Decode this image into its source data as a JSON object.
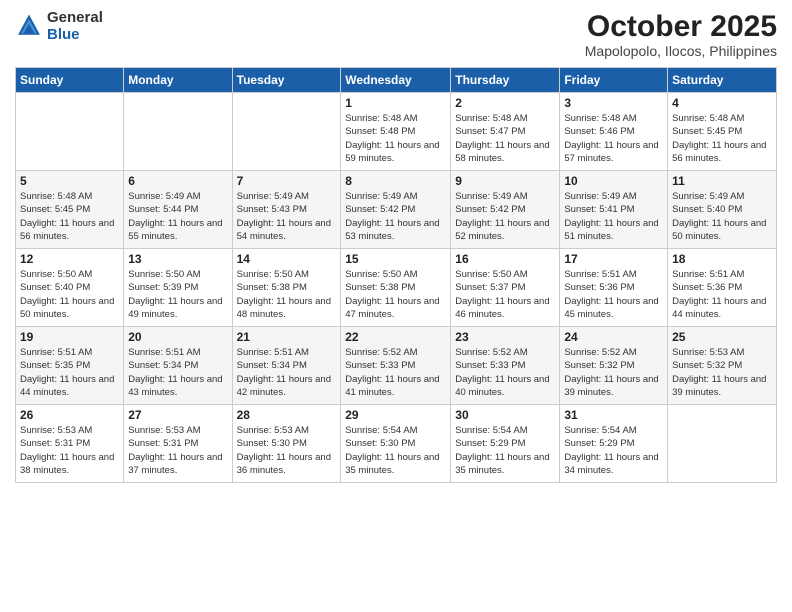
{
  "logo": {
    "general": "General",
    "blue": "Blue"
  },
  "title": "October 2025",
  "location": "Mapolopolo, Ilocos, Philippines",
  "days_of_week": [
    "Sunday",
    "Monday",
    "Tuesday",
    "Wednesday",
    "Thursday",
    "Friday",
    "Saturday"
  ],
  "weeks": [
    [
      {
        "day": "",
        "info": ""
      },
      {
        "day": "",
        "info": ""
      },
      {
        "day": "",
        "info": ""
      },
      {
        "day": "1",
        "info": "Sunrise: 5:48 AM\nSunset: 5:48 PM\nDaylight: 11 hours\nand 59 minutes."
      },
      {
        "day": "2",
        "info": "Sunrise: 5:48 AM\nSunset: 5:47 PM\nDaylight: 11 hours\nand 58 minutes."
      },
      {
        "day": "3",
        "info": "Sunrise: 5:48 AM\nSunset: 5:46 PM\nDaylight: 11 hours\nand 57 minutes."
      },
      {
        "day": "4",
        "info": "Sunrise: 5:48 AM\nSunset: 5:45 PM\nDaylight: 11 hours\nand 56 minutes."
      }
    ],
    [
      {
        "day": "5",
        "info": "Sunrise: 5:48 AM\nSunset: 5:45 PM\nDaylight: 11 hours\nand 56 minutes."
      },
      {
        "day": "6",
        "info": "Sunrise: 5:49 AM\nSunset: 5:44 PM\nDaylight: 11 hours\nand 55 minutes."
      },
      {
        "day": "7",
        "info": "Sunrise: 5:49 AM\nSunset: 5:43 PM\nDaylight: 11 hours\nand 54 minutes."
      },
      {
        "day": "8",
        "info": "Sunrise: 5:49 AM\nSunset: 5:42 PM\nDaylight: 11 hours\nand 53 minutes."
      },
      {
        "day": "9",
        "info": "Sunrise: 5:49 AM\nSunset: 5:42 PM\nDaylight: 11 hours\nand 52 minutes."
      },
      {
        "day": "10",
        "info": "Sunrise: 5:49 AM\nSunset: 5:41 PM\nDaylight: 11 hours\nand 51 minutes."
      },
      {
        "day": "11",
        "info": "Sunrise: 5:49 AM\nSunset: 5:40 PM\nDaylight: 11 hours\nand 50 minutes."
      }
    ],
    [
      {
        "day": "12",
        "info": "Sunrise: 5:50 AM\nSunset: 5:40 PM\nDaylight: 11 hours\nand 50 minutes."
      },
      {
        "day": "13",
        "info": "Sunrise: 5:50 AM\nSunset: 5:39 PM\nDaylight: 11 hours\nand 49 minutes."
      },
      {
        "day": "14",
        "info": "Sunrise: 5:50 AM\nSunset: 5:38 PM\nDaylight: 11 hours\nand 48 minutes."
      },
      {
        "day": "15",
        "info": "Sunrise: 5:50 AM\nSunset: 5:38 PM\nDaylight: 11 hours\nand 47 minutes."
      },
      {
        "day": "16",
        "info": "Sunrise: 5:50 AM\nSunset: 5:37 PM\nDaylight: 11 hours\nand 46 minutes."
      },
      {
        "day": "17",
        "info": "Sunrise: 5:51 AM\nSunset: 5:36 PM\nDaylight: 11 hours\nand 45 minutes."
      },
      {
        "day": "18",
        "info": "Sunrise: 5:51 AM\nSunset: 5:36 PM\nDaylight: 11 hours\nand 44 minutes."
      }
    ],
    [
      {
        "day": "19",
        "info": "Sunrise: 5:51 AM\nSunset: 5:35 PM\nDaylight: 11 hours\nand 44 minutes."
      },
      {
        "day": "20",
        "info": "Sunrise: 5:51 AM\nSunset: 5:34 PM\nDaylight: 11 hours\nand 43 minutes."
      },
      {
        "day": "21",
        "info": "Sunrise: 5:51 AM\nSunset: 5:34 PM\nDaylight: 11 hours\nand 42 minutes."
      },
      {
        "day": "22",
        "info": "Sunrise: 5:52 AM\nSunset: 5:33 PM\nDaylight: 11 hours\nand 41 minutes."
      },
      {
        "day": "23",
        "info": "Sunrise: 5:52 AM\nSunset: 5:33 PM\nDaylight: 11 hours\nand 40 minutes."
      },
      {
        "day": "24",
        "info": "Sunrise: 5:52 AM\nSunset: 5:32 PM\nDaylight: 11 hours\nand 39 minutes."
      },
      {
        "day": "25",
        "info": "Sunrise: 5:53 AM\nSunset: 5:32 PM\nDaylight: 11 hours\nand 39 minutes."
      }
    ],
    [
      {
        "day": "26",
        "info": "Sunrise: 5:53 AM\nSunset: 5:31 PM\nDaylight: 11 hours\nand 38 minutes."
      },
      {
        "day": "27",
        "info": "Sunrise: 5:53 AM\nSunset: 5:31 PM\nDaylight: 11 hours\nand 37 minutes."
      },
      {
        "day": "28",
        "info": "Sunrise: 5:53 AM\nSunset: 5:30 PM\nDaylight: 11 hours\nand 36 minutes."
      },
      {
        "day": "29",
        "info": "Sunrise: 5:54 AM\nSunset: 5:30 PM\nDaylight: 11 hours\nand 35 minutes."
      },
      {
        "day": "30",
        "info": "Sunrise: 5:54 AM\nSunset: 5:29 PM\nDaylight: 11 hours\nand 35 minutes."
      },
      {
        "day": "31",
        "info": "Sunrise: 5:54 AM\nSunset: 5:29 PM\nDaylight: 11 hours\nand 34 minutes."
      },
      {
        "day": "",
        "info": ""
      }
    ]
  ]
}
